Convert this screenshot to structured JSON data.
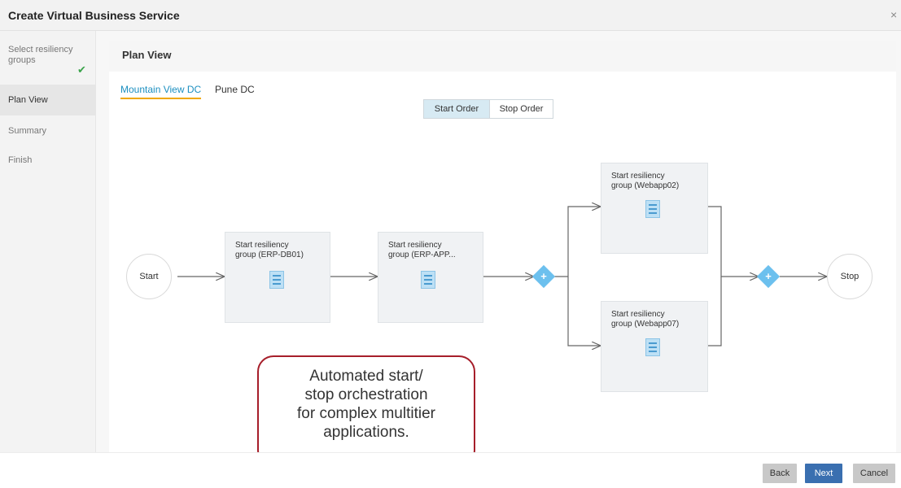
{
  "dialog": {
    "title": "Create Virtual Business Service",
    "close_glyph": "×"
  },
  "steps": [
    {
      "label_line1": "Select resiliency",
      "label_line2": "groups",
      "done": true
    },
    {
      "label": "Plan View"
    },
    {
      "label": "Summary"
    },
    {
      "label": "Finish"
    }
  ],
  "panel": {
    "title": "Plan View"
  },
  "datacenters": [
    "Mountain View DC",
    "Pune DC"
  ],
  "order_toggle": {
    "start": "Start Order",
    "stop": "Stop Order"
  },
  "flow": {
    "start": "Start",
    "stop": "Stop",
    "groups": [
      {
        "line1": "Start resiliency",
        "line2": "group (ERP-DB01)"
      },
      {
        "line1": "Start resiliency",
        "line2": "group (ERP-APP..."
      },
      {
        "line1": "Start resiliency",
        "line2": "group (Webapp02)"
      },
      {
        "line1": "Start resiliency",
        "line2": "group (Webapp07)"
      }
    ],
    "join_glyph": "+"
  },
  "callout": {
    "lines": [
      "Automated start/",
      "stop orchestration",
      "for complex multitier",
      "applications."
    ]
  },
  "footer": {
    "back": "Back",
    "next": "Next",
    "cancel": "Cancel"
  },
  "colors": {
    "accent": "#1c8fc0",
    "tab_underline": "#f0a800",
    "callout_border": "#a61e2a",
    "primary_button": "#3a6fb0",
    "check": "#3aa34a"
  }
}
